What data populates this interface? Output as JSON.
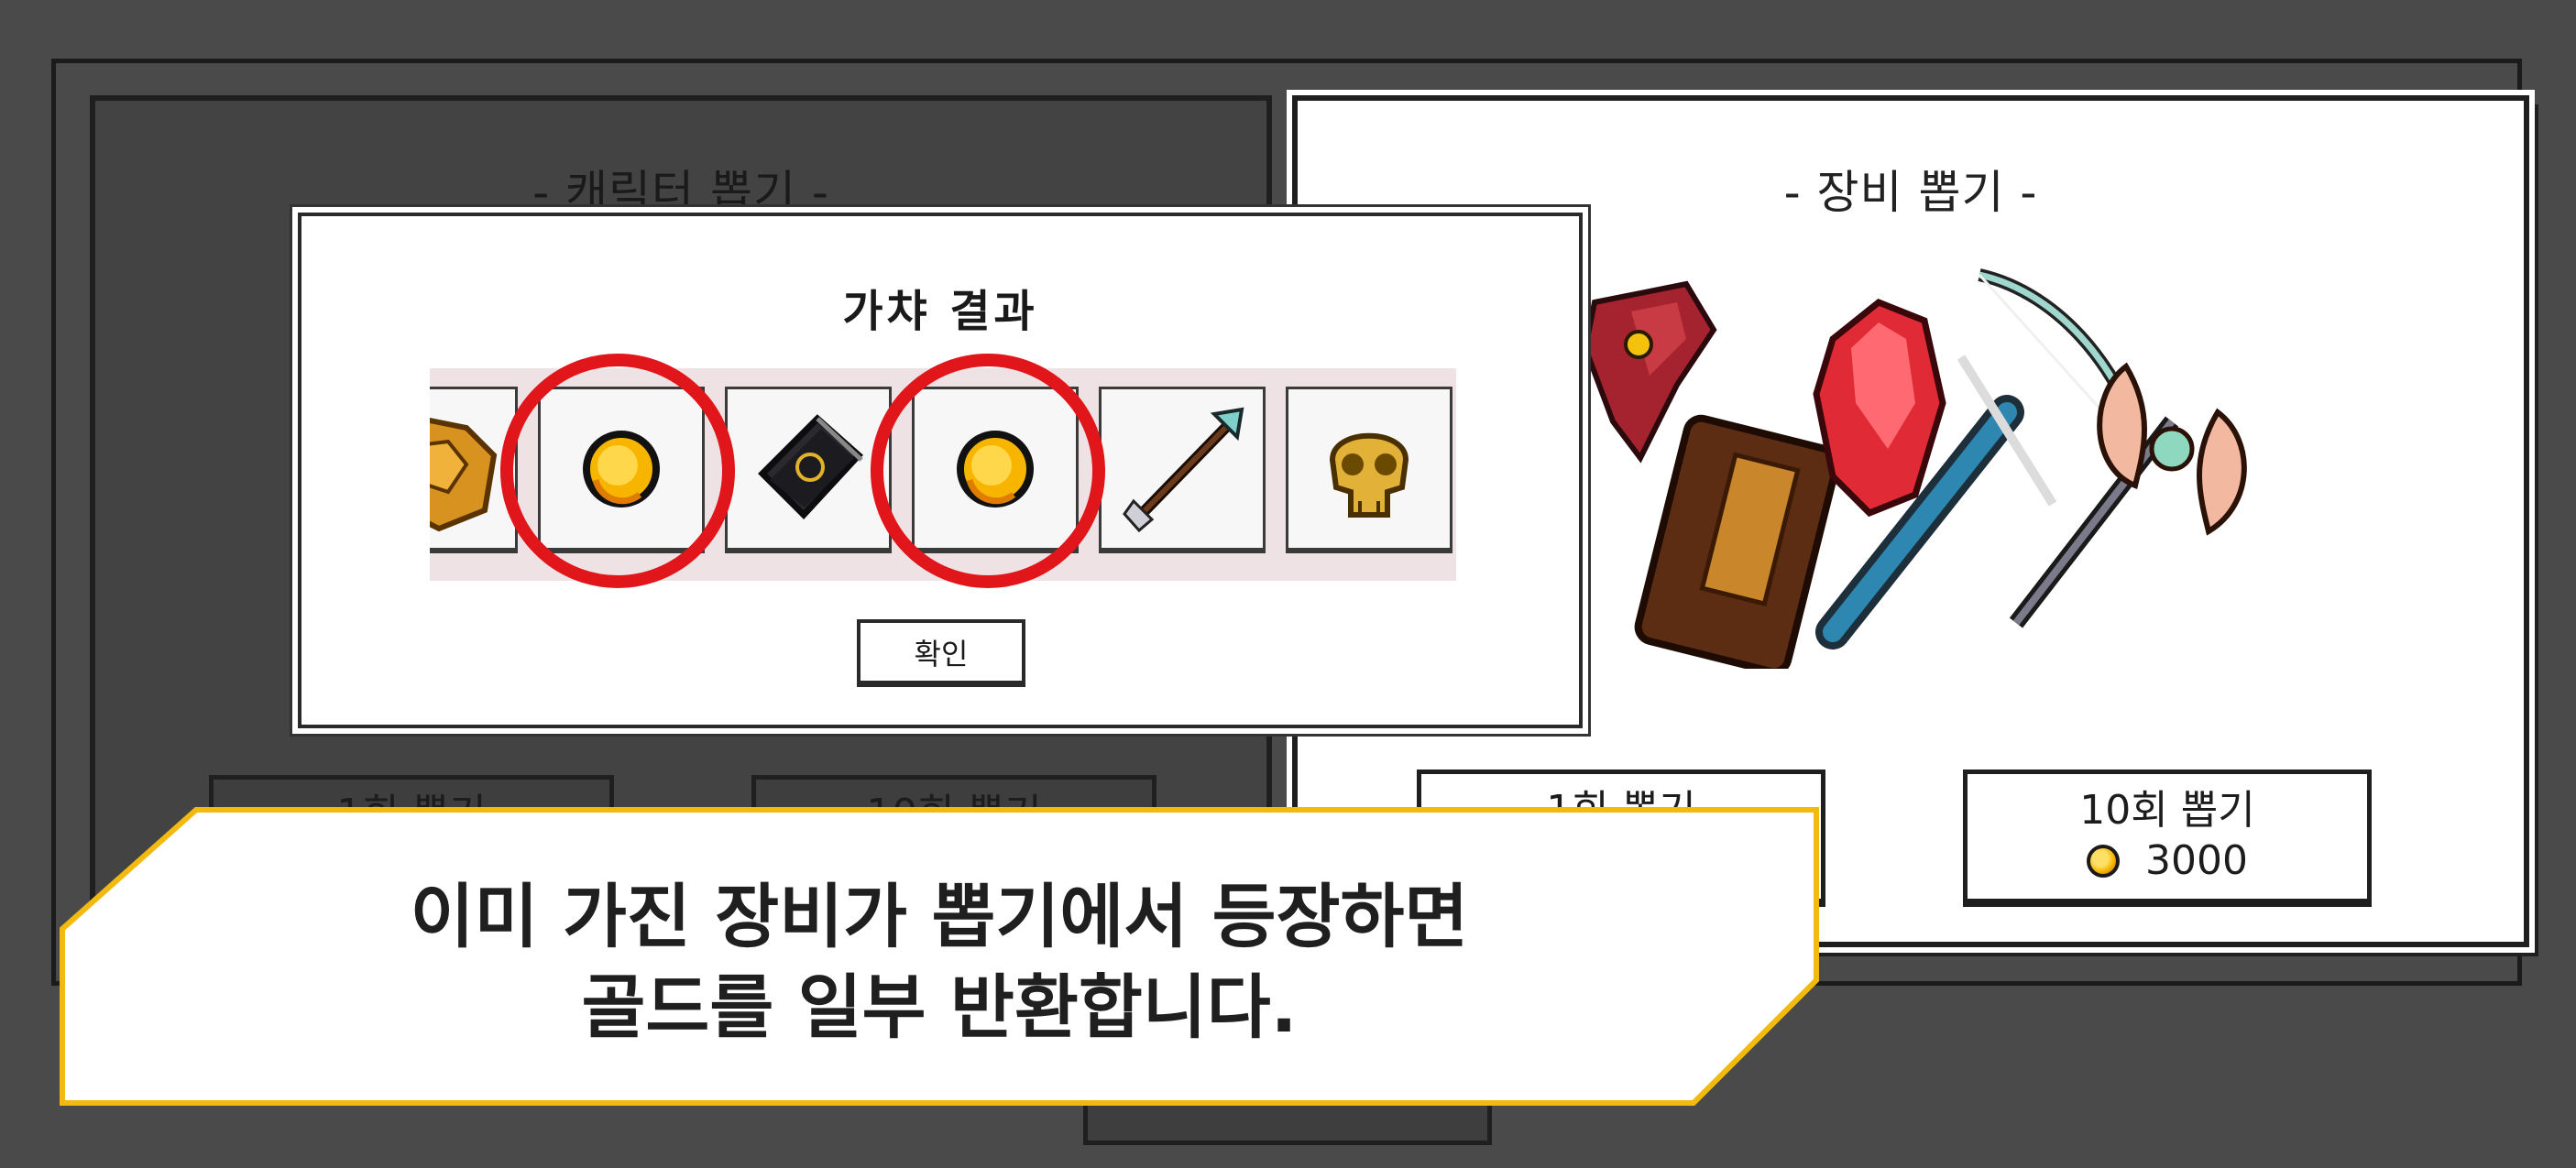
{
  "character_panel": {
    "title": "- 캐릭터 뽑기 -",
    "draw_once_label": "1회 뽑기",
    "draw_ten_label": "10회 뽑기"
  },
  "equipment_panel": {
    "title": "- 장비 뽑기 -",
    "draw_once_label": "1회 뽑기",
    "draw_ten_label": "10회 뽑기",
    "draw_ten_cost": "3000"
  },
  "gacha_result": {
    "title": "가챠 결과",
    "confirm_label": "확인",
    "items": [
      {
        "name": "golden-armor-icon",
        "highlighted": false
      },
      {
        "name": "gold-coin-icon",
        "highlighted": true
      },
      {
        "name": "spellbook-icon",
        "highlighted": false
      },
      {
        "name": "gold-coin-icon",
        "highlighted": true
      },
      {
        "name": "arrow-icon",
        "highlighted": false
      },
      {
        "name": "golden-skull-icon",
        "highlighted": false
      }
    ]
  },
  "banner": {
    "line1": "이미 가진 장비가 뽑기에서 등장하면",
    "line2": "골드를 일부 반환합니다."
  },
  "colors": {
    "highlight_circle": "#e0161b",
    "banner_border": "#f2b90f",
    "background": "#4a4a4a"
  }
}
